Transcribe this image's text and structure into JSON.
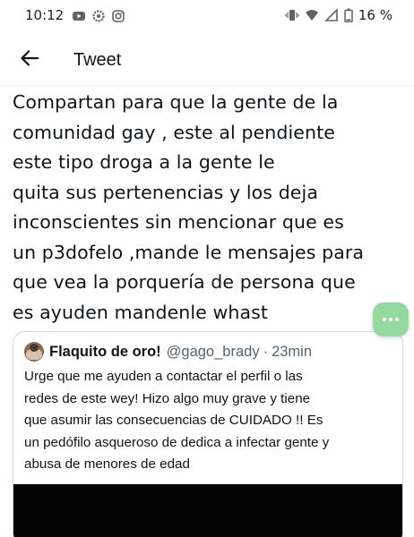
{
  "status_bar": {
    "time": "10:12",
    "left_icons": [
      "youtube-icon",
      "settings-icon",
      "instagram-icon"
    ],
    "right_icons": [
      "vibrate-icon",
      "wifi-icon",
      "signal-icon",
      "battery-icon"
    ],
    "battery": "16 %"
  },
  "header": {
    "back_icon": "arrow-left-icon",
    "title": "Tweet"
  },
  "tweet": {
    "lines": [
      "Compartan para que la gente de la",
      "comunidad gay , este al pendiente",
      "este tipo droga a la gente le",
      "quita sus pertenencias y los deja",
      "inconscientes sin mencionar que es",
      "un p3dofelo ,mande le mensajes para",
      "que vea la porquería de persona que",
      "es ayuden mandenle whast"
    ]
  },
  "fab": {
    "icon": "more-dots-icon",
    "color": "#95d9a0"
  },
  "quote": {
    "name": "Flaquito de oro!",
    "handle": "@gago_brady",
    "separator": "·",
    "time": "23min",
    "lines": [
      "Urge que me ayuden a contactar el perfil o las",
      "redes de este wey! Hizo algo muy grave y tiene",
      "que asumir las consecuencias de CUIDADO !! Es",
      "un pedófilo asqueroso de dedica a infectar gente y",
      "abusa de menores de edad"
    ]
  },
  "colors": {
    "text": "#0f1419",
    "secondary_text": "#536471",
    "border": "#cfd9de"
  }
}
